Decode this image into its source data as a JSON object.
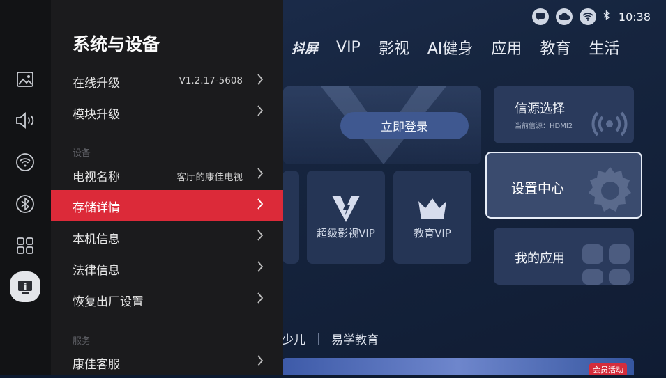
{
  "status_bar": {
    "icons": [
      "message-icon",
      "cloud-icon",
      "wifi-icon",
      "bluetooth-icon"
    ],
    "time": "10:38"
  },
  "top_nav": {
    "items": [
      "抖屏",
      "VIP",
      "影视",
      "AI健身",
      "应用",
      "教育",
      "生活"
    ]
  },
  "home": {
    "login_button": "立即登录",
    "source_card": {
      "title": "信源选择",
      "subtitle": "当前信源：HDMI2"
    },
    "settings_card": {
      "title": "设置中心"
    },
    "apps_card": {
      "title": "我的应用"
    },
    "vip_cards": [
      "超级影视VIP",
      "教育VIP"
    ],
    "bottom_tabs": [
      "少儿",
      "易学教育"
    ],
    "banner_badge": "会员活动"
  },
  "rail": {
    "icons": [
      "picture-icon",
      "sound-icon",
      "network-icon",
      "bluetooth-icon",
      "apps-icon",
      "system-info-icon"
    ],
    "active_index": 5
  },
  "panel": {
    "title": "系统与设备",
    "rows_top": [
      {
        "label": "在线升级",
        "value": "V1.2.17-5608"
      },
      {
        "label": "模块升级",
        "value": ""
      }
    ],
    "section_device": "设备",
    "rows_device": [
      {
        "label": "电视名称",
        "value": "客厅的康佳电视"
      },
      {
        "label": "存储详情",
        "value": "",
        "active": true
      },
      {
        "label": "本机信息",
        "value": ""
      },
      {
        "label": "法律信息",
        "value": ""
      },
      {
        "label": "恢复出厂设置",
        "value": ""
      }
    ],
    "section_service": "服务",
    "rows_service": [
      {
        "label": "康佳客服",
        "value": ""
      }
    ]
  },
  "colors": {
    "accent": "#dc2a39",
    "panel_bg": "#1b1b1d",
    "rail_bg": "#121315"
  }
}
